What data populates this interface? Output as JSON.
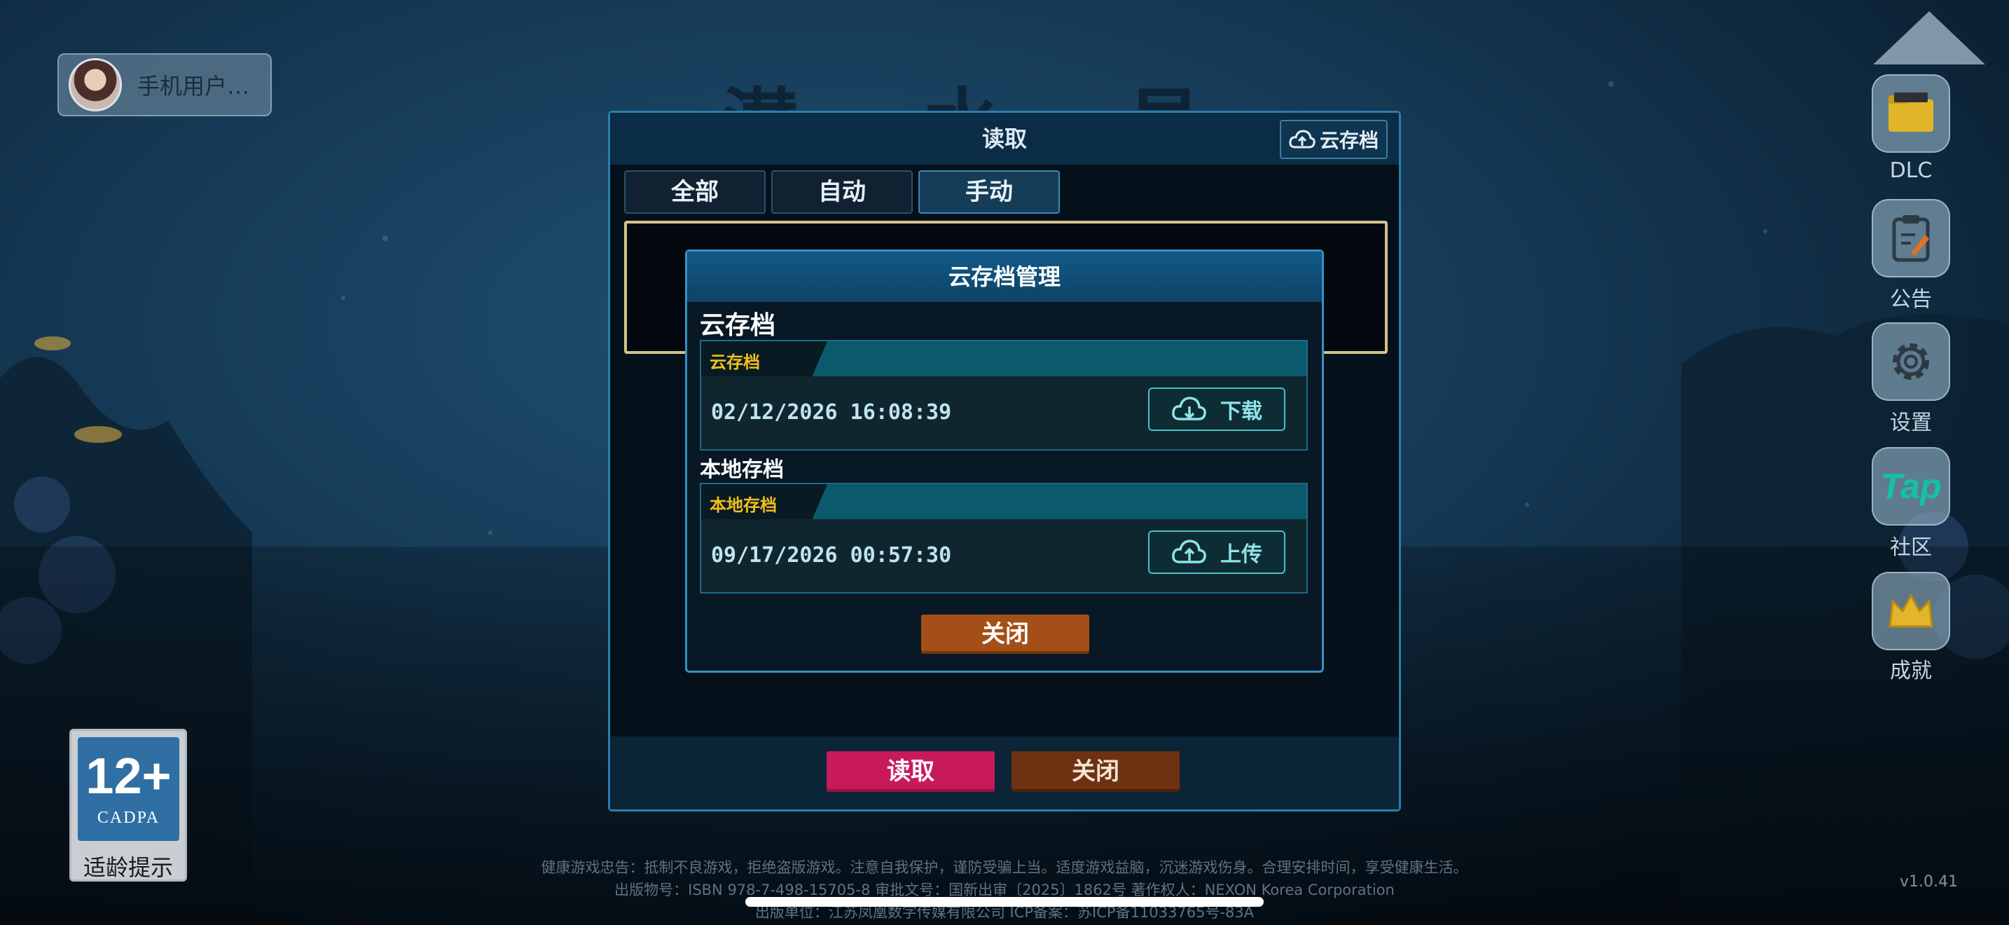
{
  "user": {
    "name": "手机用户…"
  },
  "game_title": "潜 水 员",
  "side_menu": [
    {
      "label": "DLC",
      "icon": "folder-icon"
    },
    {
      "label": "公告",
      "icon": "clipboard-icon"
    },
    {
      "label": "设置",
      "icon": "gear-icon"
    },
    {
      "label": "社区",
      "icon": "tap-logo-icon",
      "icon_text": "Tap"
    },
    {
      "label": "成就",
      "icon": "crown-icon"
    }
  ],
  "age_rating": {
    "number": "12+",
    "org": "CADPA",
    "tip": "适龄提示"
  },
  "load_dialog": {
    "title": "读取",
    "cloud_button": "云存档",
    "tabs": [
      {
        "label": "全部",
        "active": false
      },
      {
        "label": "自动",
        "active": false
      },
      {
        "label": "手动",
        "active": true
      }
    ],
    "read_button": "读取",
    "close_button": "关闭"
  },
  "cloud_modal": {
    "title": "云存档管理",
    "cloud_section": "云存档",
    "cloud_card": {
      "tag": "云存档",
      "date": "02/12/2026 16:08:39",
      "action": "下载"
    },
    "local_section": "本地存档",
    "local_card": {
      "tag": "本地存档",
      "date": "09/17/2026 00:57:30",
      "action": "上传"
    },
    "close_button": "关闭"
  },
  "footer": {
    "line1": "健康游戏忠告：抵制不良游戏，拒绝盗版游戏。注意自我保护，谨防受骗上当。适度游戏益脑，沉迷游戏伤身。合理安排时间，享受健康生活。",
    "line2": "出版物号：ISBN 978-7-498-15705-8    审批文号：国新出审〔2025〕1862号    著作权人：NEXON Korea Corporation",
    "line3": "出版单位：江苏凤凰数字传媒有限公司    ICP备案：苏ICP备11033765号-83A",
    "version": "v1.0.41"
  },
  "colors": {
    "accent_border": "#3a8fc2",
    "tag_yellow": "#f1bf1c",
    "read_pink": "#c81a5a",
    "close_brown": "#a44f17"
  }
}
